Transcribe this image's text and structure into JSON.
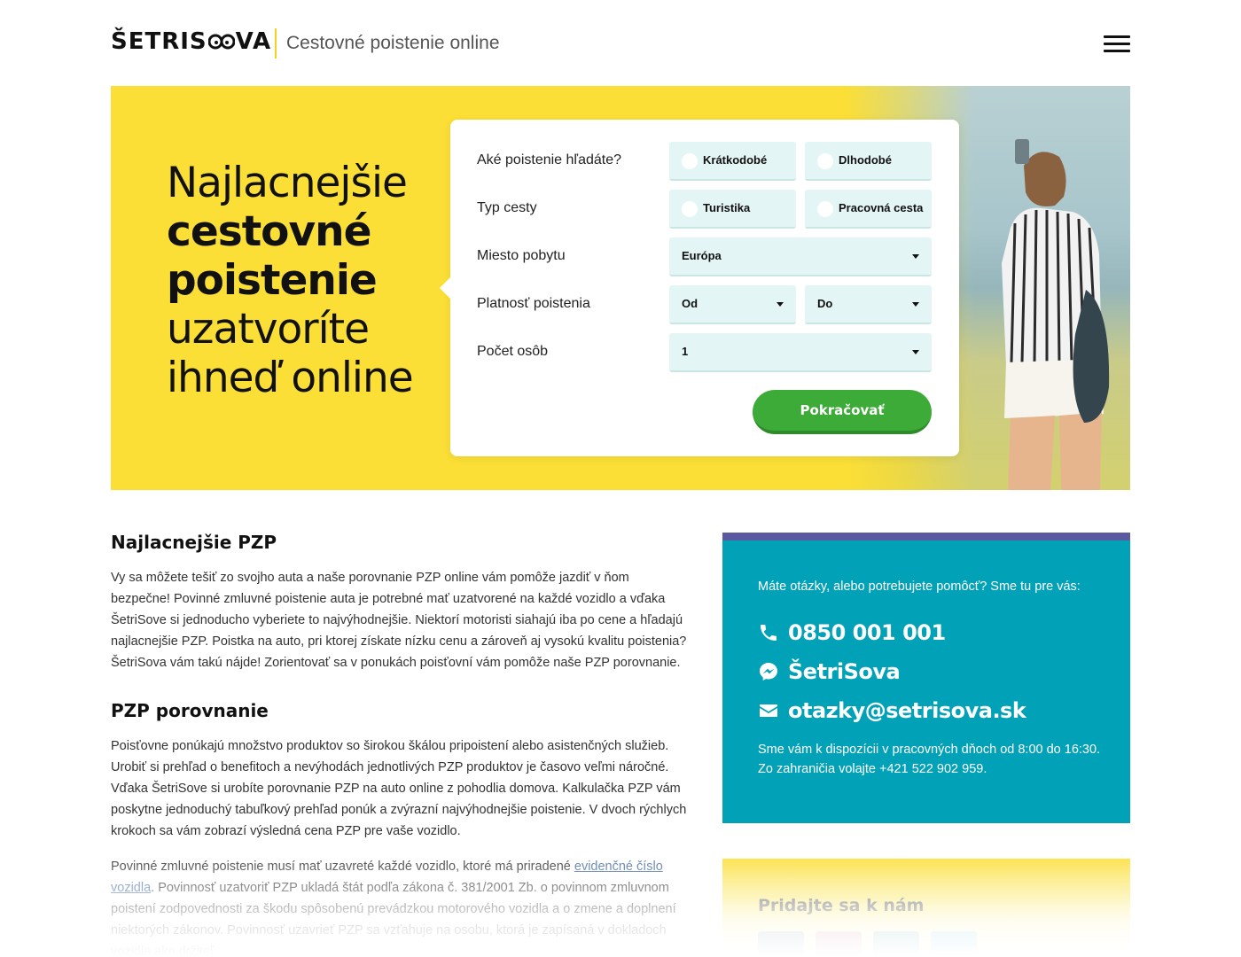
{
  "header": {
    "logo_text_before": "ŠETRIS",
    "logo_text_after": "VA",
    "tagline": "Cestovné poistenie online"
  },
  "hero": {
    "heading_line1": "Najlacnejšie",
    "heading_bold1": "cestovné",
    "heading_bold2": "poistenie",
    "heading_line4": "uzatvoríte",
    "heading_line5": "ihneď online"
  },
  "form": {
    "rows": [
      {
        "label": "Aké poistenie hľadáte?",
        "options": [
          "Krátkodobé",
          "Dlhodobé"
        ]
      },
      {
        "label": "Typ cesty",
        "options": [
          "Turistika",
          "Pracovná cesta"
        ]
      },
      {
        "label": "Miesto pobytu",
        "value": "Európa"
      },
      {
        "label": "Platnosť poistenia",
        "from": "Od",
        "to": "Do"
      },
      {
        "label": "Počet osôb",
        "value": "1"
      }
    ],
    "submit_label": "Pokračovať"
  },
  "content": {
    "heading1": "Najlacnejšie PZP",
    "para1": "Vy sa môžete tešiť zo svojho auta a naše porovnanie PZP online vám pomôže jazdiť v ňom bezpečne! Povinné zmluvné poistenie auta je potrebné mať uzatvorené na každé vozidlo a vďaka ŠetriSove si jednoducho vyberiete to najvýhodnejšie. Niektorí motoristi siahajú iba po cene a hľadajú najlacnejšie PZP. Poistka na auto, pri ktorej získate nízku cenu a zároveň aj vysokú kvalitu poistenia? ŠetriSova vám takú nájde! Zorientovať sa v ponukách poisťovní vám pomôže naše PZP porovnanie.",
    "heading2": "PZP porovnanie",
    "para2": "Poisťovne ponúkajú množstvo produktov so širokou škálou pripoistení alebo asistenčných služieb. Urobiť si prehľad o benefitoch a nevýhodách jednotlivých PZP produktov je časovo veľmi náročné. Vďaka ŠetriSove si urobíte porovnanie PZP na auto online z pohodlia domova. Kalkulačka PZP vám poskytne jednoduchý tabuľkový prehľad ponúk a zvýrazní najvýhodnejšie poistenie. V dvoch rýchlych krokoch sa vám zobrazí výsledná cena PZP pre vaše vozidlo.",
    "para3_before": "Povinné zmluvné poistenie musí mať uzavreté každé vozidlo, ktoré má priradené ",
    "para3_link": "evidenčné číslo vozidla",
    "para3_after": ". Povinnosť uzatvoriť PZP ukladá štát podľa zákona č. 381/2001 Zb. o povinnom zmluvnom poistení zodpovednosti za škodu spôsobenú prevádzkou motorového vozidla a o zmene a doplnení niektorých zákonov. Povinnosť uzavrieť PZP sa vzťahuje na osobu, ktorá je zapísaná v dokladoch vozidla ako držiteľ."
  },
  "contact": {
    "intro": "Máte otázky, alebo potrebujete pomôcť? Sme tu pre vás:",
    "phone": "0850 001 001",
    "messenger": "ŠetriSova",
    "email": "otazky@setrisova.sk",
    "hours_line1": "Sme vám k dispozícii v pracovných dňoch od 8:00 do 16:30.",
    "hours_line2": "Zo zahraničia volajte +421 522 902 959."
  },
  "social": {
    "title": "Pridajte sa k nám",
    "icons": [
      "facebook-icon",
      "instagram-icon",
      "linkedin-icon",
      "twitter-icon"
    ]
  },
  "colors": {
    "brand_yellow": "#fbdf36",
    "teal": "#01a1b8",
    "purple": "#5b5aa0",
    "green": "#3dab37",
    "field_bg": "#e3f6f5"
  }
}
